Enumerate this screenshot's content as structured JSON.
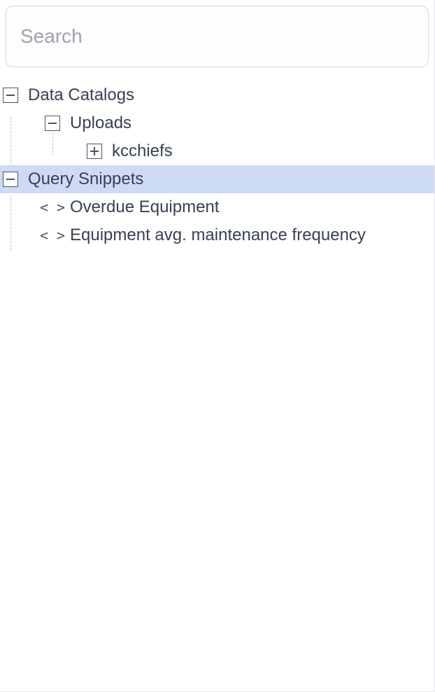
{
  "search": {
    "placeholder": "Search",
    "value": ""
  },
  "tree": {
    "data_catalogs": {
      "label": "Data Catalogs",
      "expanded": true,
      "children": {
        "uploads": {
          "label": "Uploads",
          "expanded": true,
          "children": {
            "kcchiefs": {
              "label": "kcchiefs",
              "expanded": false
            }
          }
        }
      }
    },
    "query_snippets": {
      "label": "Query Snippets",
      "expanded": true,
      "selected": true,
      "children": {
        "overdue": {
          "label": "Overdue Equipment"
        },
        "frequency": {
          "label": "Equipment avg. maintenance frequency"
        }
      }
    }
  }
}
